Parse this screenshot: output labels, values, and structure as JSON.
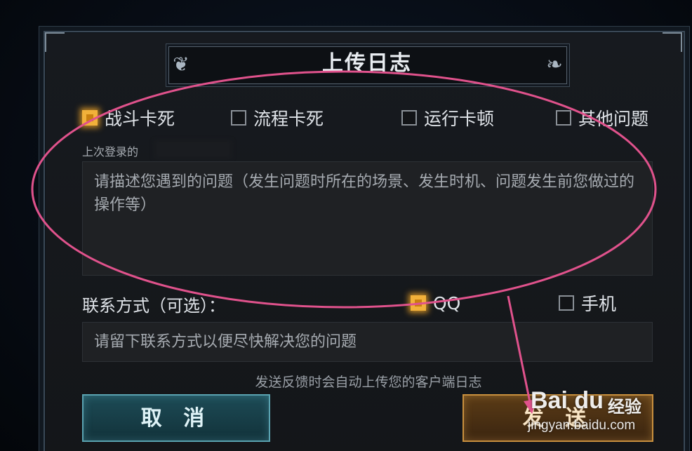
{
  "dialog": {
    "title": "上传日志"
  },
  "categories": [
    {
      "label": "战斗卡死",
      "checked": true
    },
    {
      "label": "流程卡死",
      "checked": false
    },
    {
      "label": "运行卡顿",
      "checked": false
    },
    {
      "label": "其他问题",
      "checked": false
    }
  ],
  "last_login_label": "上次登录的",
  "description": {
    "placeholder": "请描述您遇到的问题（发生问题时所在的场景、发生时机、问题发生前您做过的操作等）"
  },
  "contact": {
    "label": "联系方式（可选）：",
    "options": [
      {
        "label": "QQ",
        "checked": true
      },
      {
        "label": "手机",
        "checked": false
      }
    ],
    "placeholder": "请留下联系方式以便尽快解决您的问题"
  },
  "note": "发送反馈时会自动上传您的客户端日志",
  "buttons": {
    "cancel": "取 消",
    "send": "发 送"
  },
  "watermark": {
    "brand": "Bai du",
    "sub": "经验",
    "url": "jingyan.baidu.com"
  },
  "colors": {
    "annotation": "#e0528c",
    "checked": "#f2b13a",
    "cancel_border": "#5aa3b1",
    "send_border": "#c9903e"
  }
}
